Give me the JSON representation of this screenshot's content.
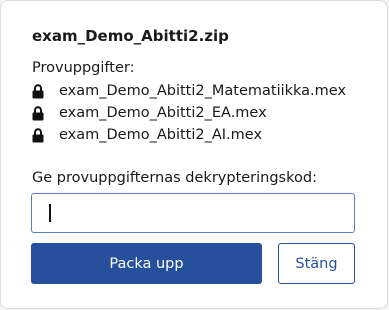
{
  "dialog": {
    "title": "exam_Demo_Abitti2.zip",
    "files_heading": "Provuppgifter:",
    "files": [
      {
        "icon": "lock-icon",
        "name": "exam_Demo_Abitti2_Matematiikka.mex"
      },
      {
        "icon": "lock-icon",
        "name": "exam_Demo_Abitti2_EA.mex"
      },
      {
        "icon": "lock-icon",
        "name": "exam_Demo_Abitti2_AI.mex"
      }
    ],
    "code_label": "Ge provuppgifternas dekrypteringskod:",
    "code_value": "",
    "unpack_label": "Packa upp",
    "close_label": "Stäng"
  },
  "colors": {
    "accent": "#26509b",
    "input_border": "#5b7ec2",
    "background": "#ffffff"
  }
}
